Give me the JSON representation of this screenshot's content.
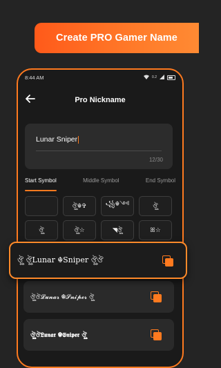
{
  "banner": {
    "pre": "Create",
    "pro": "PRO",
    "post": "Gamer Name"
  },
  "status": {
    "time": "8:44 AM",
    "net": "0.2",
    "brand_color": "#ff7a1f"
  },
  "appbar": {
    "back_icon": "arrow-left-icon",
    "title": "Pro Nickname"
  },
  "input": {
    "value": "Lunar Sniper",
    "counter": "12/30"
  },
  "tabs": [
    {
      "label": "Start Symbol",
      "active": true
    },
    {
      "label": "Middle Symbol",
      "active": false
    },
    {
      "label": "End Symbol",
      "active": false
    }
  ],
  "symbols": [
    "",
    "ঔৣ☬✞",
    "꧁☬༺",
    "ঔৣ",
    "ঔৣ",
    "ঔৣ☆",
    "◥ঔৣ",
    "ꕤ☆"
  ],
  "results": [
    {
      "text": "ঔৣ ঔৣLunar ☬Sniper ঔৣঔ",
      "highlighted": true
    },
    {
      "text": "ঔৣঔ𝓛𝓾𝓷𝓪𝓻 ☬𝓢𝓷𝓲𝓹𝓮𝓻 ঔৣ",
      "highlighted": false
    },
    {
      "text": "ঔৣঔ𝕷𝖚𝖓𝖆𝖗 ☬𝕾𝖓𝖎𝖕𝖊𝖗 ঔৣ",
      "highlighted": false
    }
  ]
}
